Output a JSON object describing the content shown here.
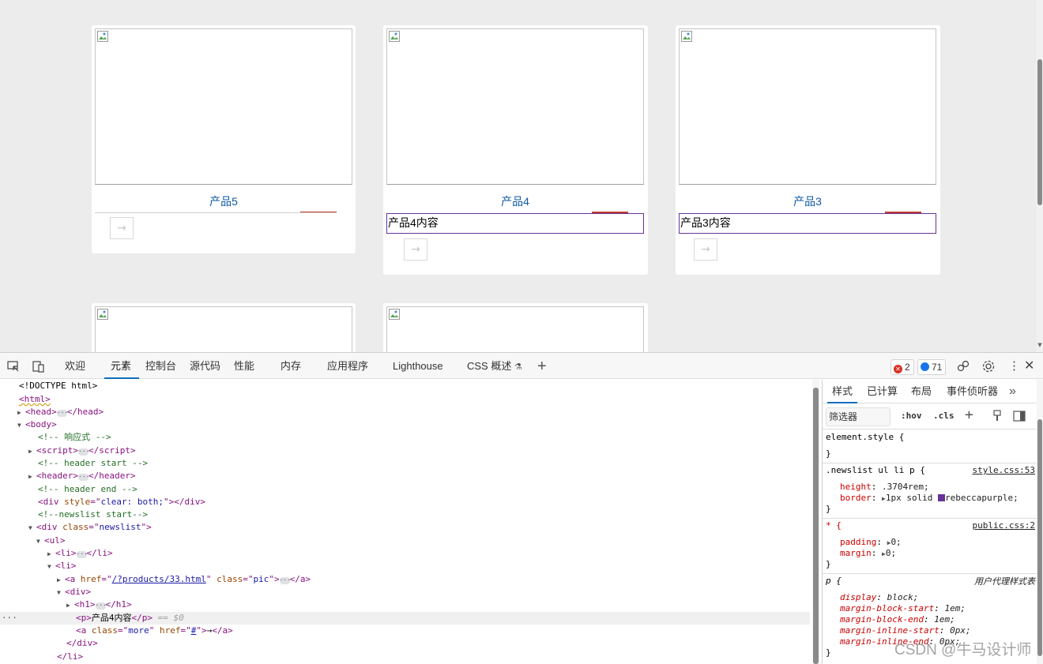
{
  "page": {
    "products": [
      {
        "title": "产品5",
        "content": "",
        "more": "→"
      },
      {
        "title": "产品4",
        "content": "产品4内容",
        "more": "→"
      },
      {
        "title": "产品3",
        "content": "产品3内容",
        "more": "→"
      }
    ]
  },
  "devtools": {
    "tabs": [
      "欢迎",
      "元素",
      "控制台",
      "源代码",
      "性能",
      "内存",
      "应用程序",
      "Lighthouse",
      "CSS 概述"
    ],
    "active_tab": "元素",
    "errors": "2",
    "messages": "71",
    "dom": [
      {
        "t": "plain",
        "text": "<!DOCTYPE html>"
      },
      {
        "t": "open",
        "tag": "html"
      },
      {
        "t": "collapsed",
        "tag": "head"
      },
      {
        "t": "open",
        "tag": "body"
      },
      {
        "t": "comment",
        "text": "<!-- 响应式 -->"
      },
      {
        "t": "collapsed",
        "tag": "script"
      },
      {
        "t": "comment",
        "text": "<!-- header start -->"
      },
      {
        "t": "collapsed",
        "tag": "header"
      },
      {
        "t": "comment",
        "text": "<!-- header end -->"
      },
      {
        "t": "div_clear",
        "attr": "style",
        "val": "clear: both;"
      },
      {
        "t": "comment",
        "text": "<!--newslist start-->"
      },
      {
        "t": "open_attr",
        "tag": "div",
        "attr": "class",
        "val": "newslist"
      },
      {
        "t": "open",
        "tag": "ul"
      },
      {
        "t": "collapsed",
        "tag": "li"
      },
      {
        "t": "open",
        "tag": "li"
      },
      {
        "t": "anchor",
        "href": "/?products/33.html",
        "cls": "pic"
      },
      {
        "t": "open",
        "tag": "div"
      },
      {
        "t": "collapsed",
        "tag": "h1"
      },
      {
        "t": "p",
        "text": "产品4内容",
        "marker": "== $0"
      },
      {
        "t": "more",
        "cls": "more",
        "href": "#",
        "text": "→"
      },
      {
        "t": "close",
        "tag": "div"
      },
      {
        "t": "close",
        "tag": "li"
      }
    ],
    "styles_tabs": [
      "样式",
      "已计算",
      "布局",
      "事件侦听器"
    ],
    "filter_placeholder": "筛选器",
    "hov": ":hov",
    "cls": ".cls",
    "rules": {
      "element_style": "element.style {",
      "close": "}",
      "r1_selector": ".newslist ul li p {",
      "r1_src": "style.css:53",
      "r1_p1_name": "height",
      "r1_p1_val": ".3704rem;",
      "r1_p2_name": "border",
      "r1_p2_val_a": "1px solid",
      "r1_p2_val_b": "rebeccapurple;",
      "r1_color": "#663399",
      "r2_selector": "* {",
      "r2_src": "public.css:2",
      "r2_p1_name": "padding",
      "r2_p1_val": "0;",
      "r2_p2_name": "margin",
      "r2_p2_val": "0;",
      "r3_selector": "p {",
      "r3_src": "用户代理样式表",
      "r3_props": [
        {
          "n": "display",
          "v": "block;"
        },
        {
          "n": "margin-block-start",
          "v": "1em;"
        },
        {
          "n": "margin-block-end",
          "v": "1em;"
        },
        {
          "n": "margin-inline-start",
          "v": "0px;"
        },
        {
          "n": "margin-inline-end",
          "v": "0px;"
        }
      ]
    }
  },
  "watermark": "CSDN @牛马设计师",
  "colors": {
    "accent": "#0f6cbd",
    "product_title": "#0e5aa7",
    "outline": "#663399"
  }
}
